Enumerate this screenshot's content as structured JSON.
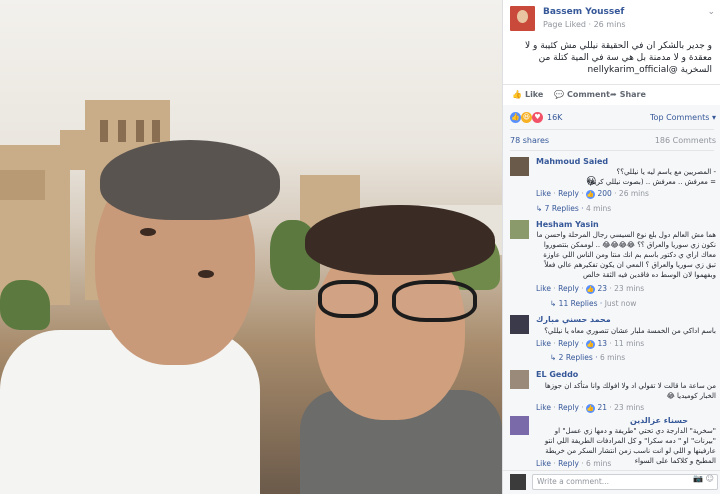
{
  "post": {
    "page_name": "Bassem Youssef",
    "page_liked": "Page Liked",
    "time": "26 mins",
    "text": "و جدير بالشكر ان في الحقيقة نيللي مش كئيبة و لا معقدة و لا مدمنة بل هي سة في المية كتلة من السخرية @nellykarim_official"
  },
  "actions": {
    "like": "Like",
    "comment": "Comment",
    "share": "Share"
  },
  "reactions": {
    "count": "16K",
    "top_comments": "Top Comments",
    "shares": "78 shares",
    "comments": "186 Comments"
  },
  "comments": [
    {
      "name": "Mahmoud Saied",
      "text": "- المصريين مع ياسم ليه يا نيللي؟؟\n= معرفش .. معرفش .. (بصوت نيللي كريم)",
      "emoji": "😀",
      "like": "Like",
      "reply": "Reply",
      "likes": "200",
      "time": "26 mins",
      "replies": "7 Replies",
      "replies_time": "4 mins"
    },
    {
      "name": "Hesham Yasin",
      "text": "هما مش العالم دول بلع نوع السيسي رجال المرحلة واحسن ما نكون زي سوريا والعراق ؟؟ 😂😂😂😂 .. لوممكن بتتصوروا معاك اراي ي دكتور باسم بم انك منتا ومن الناس اللي عاوزة تبق زي سوريا والعراق ؟ المعي ان يكون تفكيرهم عالي فعلاً وبفهموا لان الوسط ده فاقدين فيه الثقة خالص",
      "like": "Like",
      "reply": "Reply",
      "likes": "23",
      "time": "23 mins",
      "replies": "11 Replies",
      "replies_time": "Just now"
    },
    {
      "name": "محمد حسني مبارك",
      "text": "باسم اداكي من الخمسة ملبار عشان تتصوري معاه يا نيللي؟",
      "like": "Like",
      "reply": "Reply",
      "likes": "13",
      "time": "11 mins",
      "replies": "2 Replies",
      "replies_time": "6 mins"
    },
    {
      "name": "EL Geddo",
      "text": "من ساعة ما قالت لا تقولي اد ولا افولك وانا متأكد ان جوزها الخبار كوميديا 😂",
      "like": "Like",
      "reply": "Reply",
      "likes": "21",
      "time": "23 mins"
    },
    {
      "name": "حسناء عزالدين",
      "text": "\"سخرية\" الدارجة دي تحتي \"طريفة و دمها زي عسل\" او \"بيرنات\" او \" دمه سكرا\" و كل المرادفات الطريفة اللي انتو عارفينها و اللي لو انت ناسب زمن انتشار السكر من خريطة المطبخ و كلاكما على السواء",
      "like": "Like",
      "reply": "Reply",
      "time": "6 mins"
    }
  ],
  "write": {
    "placeholder": "Write a comment..."
  },
  "icons": [
    "chevron-down-icon",
    "like-icon",
    "comment-icon",
    "share-icon",
    "camera-icon",
    "smile-icon"
  ]
}
